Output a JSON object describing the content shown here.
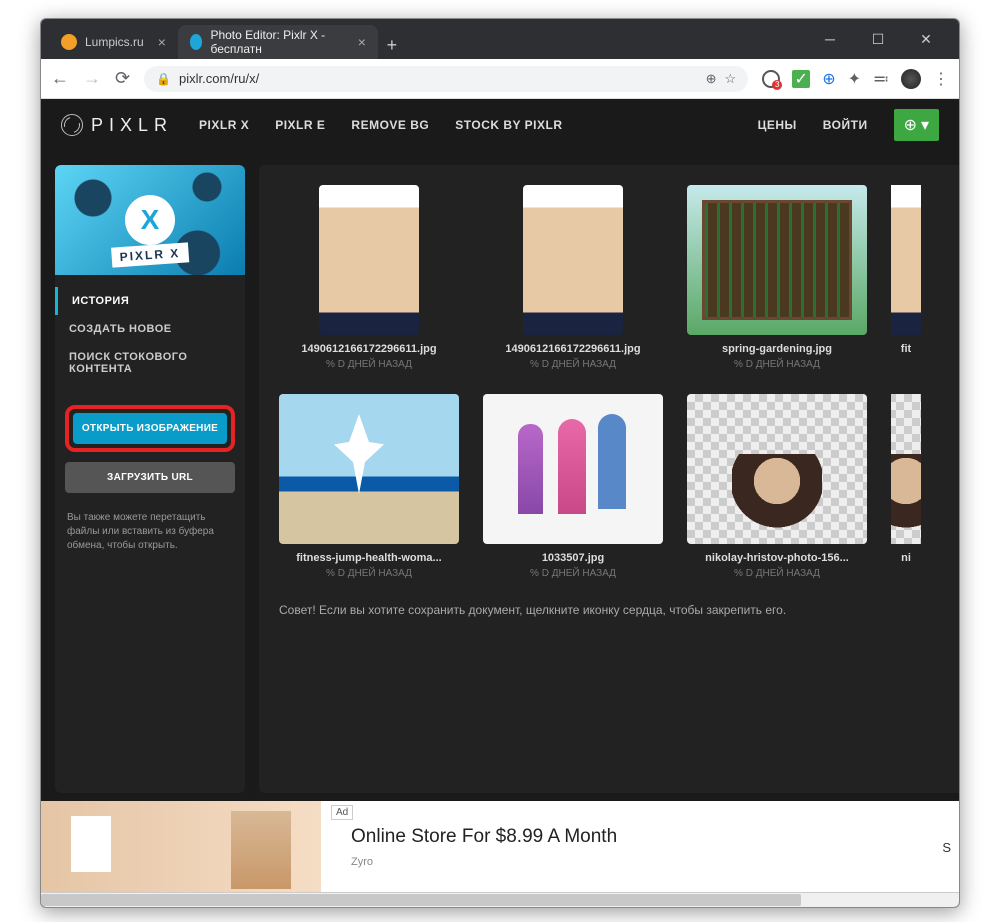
{
  "browser": {
    "tabs": [
      {
        "title": "Lumpics.ru",
        "favicon_color": "#f4a028"
      },
      {
        "title": "Photo Editor: Pixlr X - бесплатн",
        "favicon_color": "#1da6d8"
      }
    ],
    "url": "pixlr.com/ru/x/"
  },
  "nav": {
    "brand": "PIXLR",
    "links": [
      "PIXLR X",
      "PIXLR E",
      "REMOVE BG",
      "STOCK BY PIXLR",
      "ЦЕНЫ",
      "ВОЙТИ"
    ]
  },
  "sidebar": {
    "hero_x": "X",
    "hero_label": "PIXLR X",
    "menu": [
      "ИСТОРИЯ",
      "СОЗДАТЬ НОВОЕ",
      "ПОИСК СТОКОВОГО КОНТЕНТА"
    ],
    "btn_open": "ОТКРЫТЬ ИЗОБРАЖЕНИЕ",
    "btn_url": "ЗАГРУЗИТЬ URL",
    "hint": "Вы также можете перетащить файлы или вставить из буфера обмена, чтобы открыть."
  },
  "gallery": {
    "items": [
      {
        "title": "1490612166172296611.jpg",
        "sub": "% D ДНЕЙ НАЗАД"
      },
      {
        "title": "1490612166172296611.jpg",
        "sub": "% D ДНЕЙ НАЗАД"
      },
      {
        "title": "spring-gardening.jpg",
        "sub": "% D ДНЕЙ НАЗАД"
      },
      {
        "title": "fit",
        "sub": ""
      },
      {
        "title": "fitness-jump-health-woma...",
        "sub": "% D ДНЕЙ НАЗАД"
      },
      {
        "title": "1033507.jpg",
        "sub": "% D ДНЕЙ НАЗАД"
      },
      {
        "title": "nikolay-hristov-photo-156...",
        "sub": "% D ДНЕЙ НАЗАД"
      },
      {
        "title": "ni",
        "sub": ""
      }
    ],
    "tip": "Совет! Если вы хотите сохранить документ, щелкните иконку сердца, чтобы закрепить его."
  },
  "ad": {
    "badge": "Ad",
    "title": "Online Store For $8.99 A Month",
    "sub": "Zyro",
    "cut": "S"
  }
}
